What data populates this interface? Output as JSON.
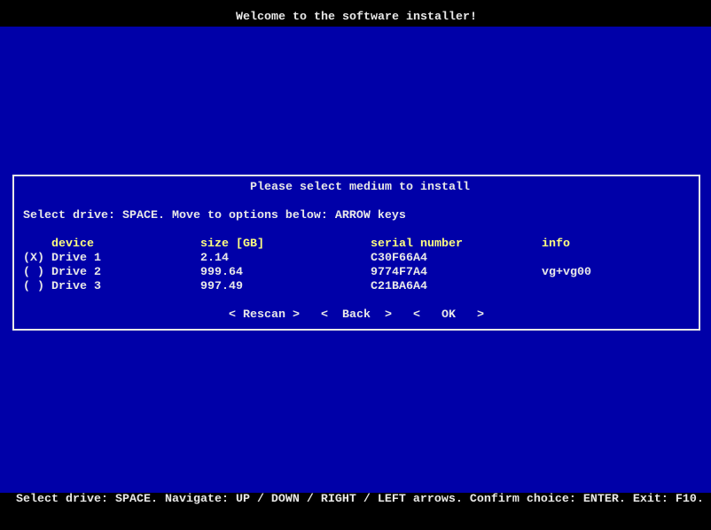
{
  "window_title": "Welcome to the software installer!",
  "dialog": {
    "title": "Please select medium to install",
    "instructions": "Select drive: SPACE. Move to options below: ARROW keys",
    "columns": [
      "device",
      "size [GB]",
      "serial number",
      "info"
    ],
    "rows": [
      {
        "selected": "(X)",
        "device": "Drive 1",
        "size": "2.14",
        "serial": "C30F66A4",
        "info": ""
      },
      {
        "selected": "( )",
        "device": "Drive 2",
        "size": "999.64",
        "serial": "9774F7A4",
        "info": "vg+vg00"
      },
      {
        "selected": "( )",
        "device": "Drive 3",
        "size": "997.49",
        "serial": "C21BA6A4",
        "info": ""
      }
    ],
    "buttons": [
      "< Rescan >",
      "<  Back  >",
      "<   OK   >"
    ]
  },
  "status_bar": "Select drive: SPACE. Navigate: UP / DOWN / RIGHT / LEFT arrows. Confirm choice: ENTER. Exit: F10.",
  "colors": {
    "background": "#0000a8",
    "bars": "#000000",
    "text": "#e8e8e8",
    "header": "#ffff80"
  }
}
